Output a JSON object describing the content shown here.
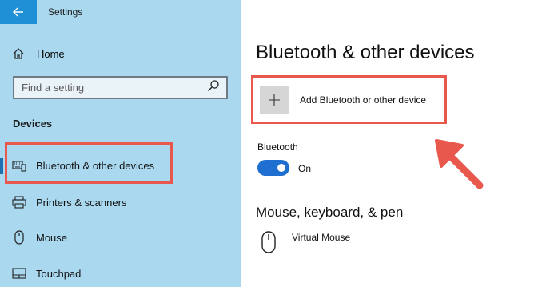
{
  "window": {
    "title": "Settings",
    "back_icon": "arrow-left-icon"
  },
  "sidebar": {
    "home_label": "Home",
    "search_placeholder": "Find a setting",
    "section_title": "Devices",
    "items": [
      {
        "label": "Bluetooth & other devices",
        "icon": "bluetooth-devices-icon",
        "selected": true
      },
      {
        "label": "Printers & scanners",
        "icon": "printer-icon",
        "selected": false
      },
      {
        "label": "Mouse",
        "icon": "mouse-icon",
        "selected": false
      },
      {
        "label": "Touchpad",
        "icon": "touchpad-icon",
        "selected": false
      }
    ]
  },
  "main": {
    "title": "Bluetooth & other devices",
    "add_button_label": "Add Bluetooth or other device",
    "bluetooth_label": "Bluetooth",
    "bluetooth_state": "On",
    "bluetooth_on": true,
    "section_mouse": "Mouse, keyboard, & pen",
    "devices": [
      {
        "label": "Virtual Mouse",
        "icon": "mouse-icon"
      }
    ]
  },
  "colors": {
    "sidebar_bg": "#a9d8ef",
    "accent": "#1f6fd1",
    "highlight": "#e8584d"
  }
}
